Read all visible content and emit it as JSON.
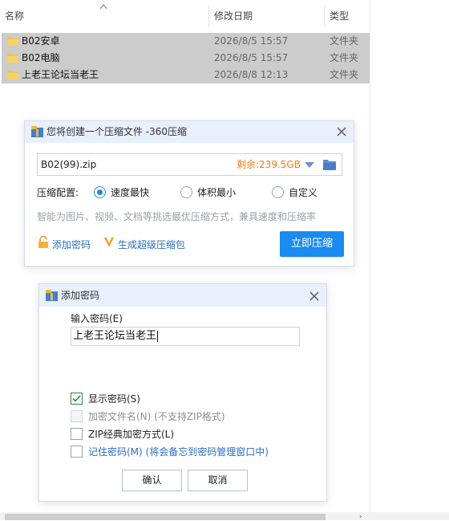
{
  "explorer": {
    "columns": {
      "name": "名称",
      "modified": "修改日期",
      "type": "类型"
    },
    "files": [
      {
        "name": "B02安卓",
        "date": "2026/8/5 15:57",
        "type": "文件夹"
      },
      {
        "name": "B02电脑",
        "date": "2026/8/5 15:57",
        "type": "文件夹"
      },
      {
        "name": "上老王论坛当老王",
        "date": "2026/8/8 12:13",
        "type": "文件夹"
      }
    ],
    "colors": {
      "selected_row": "#cccccc",
      "folder": "#f5c542"
    }
  },
  "compress_dialog": {
    "title": "您将创建一个压缩文件 -360压缩",
    "filename": "B02(99).zip",
    "free_space": "剩余:239.5GB",
    "config_label": "压缩配置:",
    "options": [
      {
        "label": "速度最快",
        "selected": true
      },
      {
        "label": "体积最小",
        "selected": false
      },
      {
        "label": "自定义",
        "selected": false
      }
    ],
    "hint": "智能为图片、视频、文档等挑选最优压缩方式，兼具速度和压缩率",
    "add_password_link": "添加密码",
    "super_pack_link": "生成超级压缩包",
    "compress_button": "立即压缩",
    "accent_color": "#1a8cf0"
  },
  "password_dialog": {
    "title": "添加密码",
    "input_label": "输入密码(E)",
    "password_value": "上老王论坛当老王",
    "checkboxes": [
      {
        "label": "显示密码(S)",
        "checked": true,
        "disabled": false
      },
      {
        "label": "加密文件名(N) (不支持ZIP格式)",
        "checked": false,
        "disabled": true
      },
      {
        "label": "ZIP经典加密方式(L)",
        "checked": false,
        "disabled": false
      },
      {
        "label": "记住密码(M) (将会备忘到密码管理窗口中)",
        "checked": false,
        "disabled": false
      }
    ],
    "ok_button": "确认",
    "cancel_button": "取消"
  }
}
